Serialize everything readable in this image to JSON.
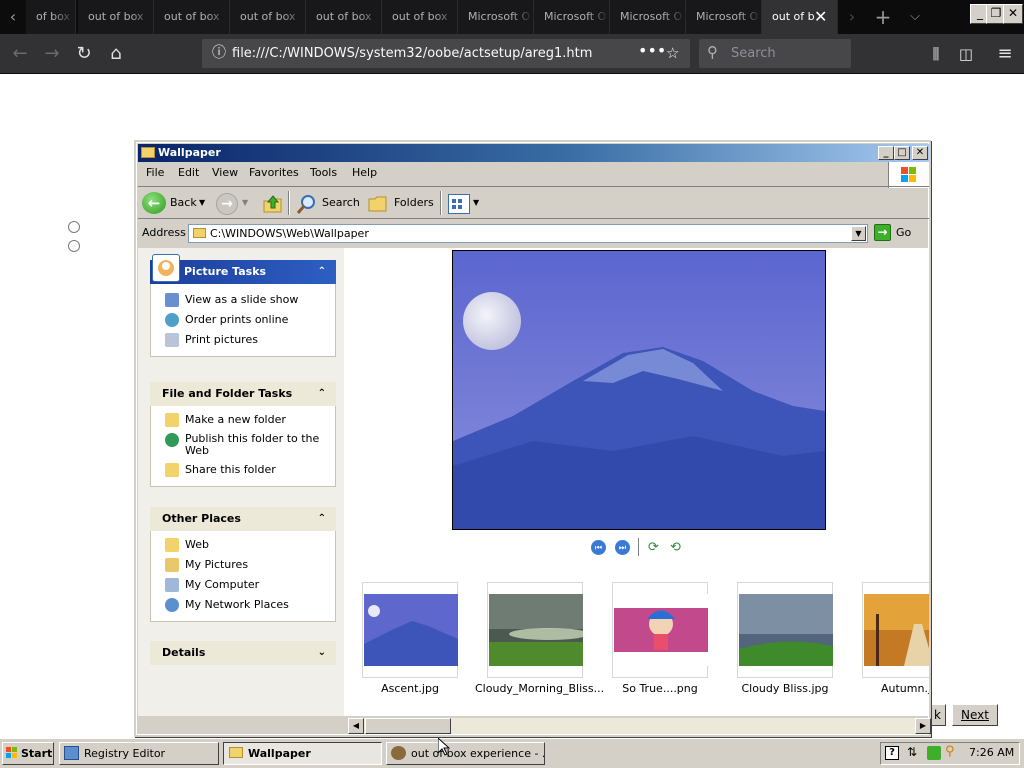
{
  "browser": {
    "tabs": [
      {
        "label": "of box"
      },
      {
        "label": "out of box"
      },
      {
        "label": "out of box"
      },
      {
        "label": "out of box"
      },
      {
        "label": "out of box"
      },
      {
        "label": "out of box"
      },
      {
        "label": "Microsoft O"
      },
      {
        "label": "Microsoft O"
      },
      {
        "label": "Microsoft O"
      },
      {
        "label": "Microsoft O"
      },
      {
        "label": "out of b"
      }
    ],
    "url": "file:///C:/WINDOWS/system32/oobe/actsetup/areg1.htm",
    "search_placeholder": "Search",
    "colors": {
      "tabbar": "#0c0c0d",
      "navbar": "#323234",
      "urlbar": "#474749"
    }
  },
  "page": {
    "back_button_fragment": "k",
    "next_button": "Next"
  },
  "explorer": {
    "title": "Wallpaper",
    "menu": [
      "File",
      "Edit",
      "View",
      "Favorites",
      "Tools",
      "Help"
    ],
    "toolbar": {
      "back": "Back",
      "search": "Search",
      "folders": "Folders"
    },
    "address_label": "Address",
    "address": "C:\\WINDOWS\\Web\\Wallpaper",
    "go": "Go",
    "picture_tasks": {
      "title": "Picture Tasks",
      "items": [
        "View as a slide show",
        "Order prints online",
        "Print pictures"
      ]
    },
    "file_tasks": {
      "title": "File and Folder Tasks",
      "items": [
        "Make a new folder",
        "Publish this folder to the Web",
        "Share this folder"
      ]
    },
    "other_places": {
      "title": "Other Places",
      "items": [
        "Web",
        "My Pictures",
        "My Computer",
        "My Network Places"
      ]
    },
    "details": {
      "title": "Details"
    },
    "thumbnails": [
      {
        "label": "Ascent.jpg"
      },
      {
        "label": "Cloudy_Morning_Bliss..."
      },
      {
        "label": "So True....png"
      },
      {
        "label": "Cloudy Bliss.jpg"
      },
      {
        "label": "Autumn.jp"
      }
    ],
    "colors": {
      "title_start": "#0a246a",
      "title_end": "#a6caf0",
      "task_header": "#215dc6",
      "face": "#d4d0c8"
    }
  },
  "taskbar": {
    "start": "Start",
    "buttons": [
      "Registry Editor",
      "Wallpaper",
      "out of box experience - ..."
    ],
    "clock": "7:26 AM"
  }
}
